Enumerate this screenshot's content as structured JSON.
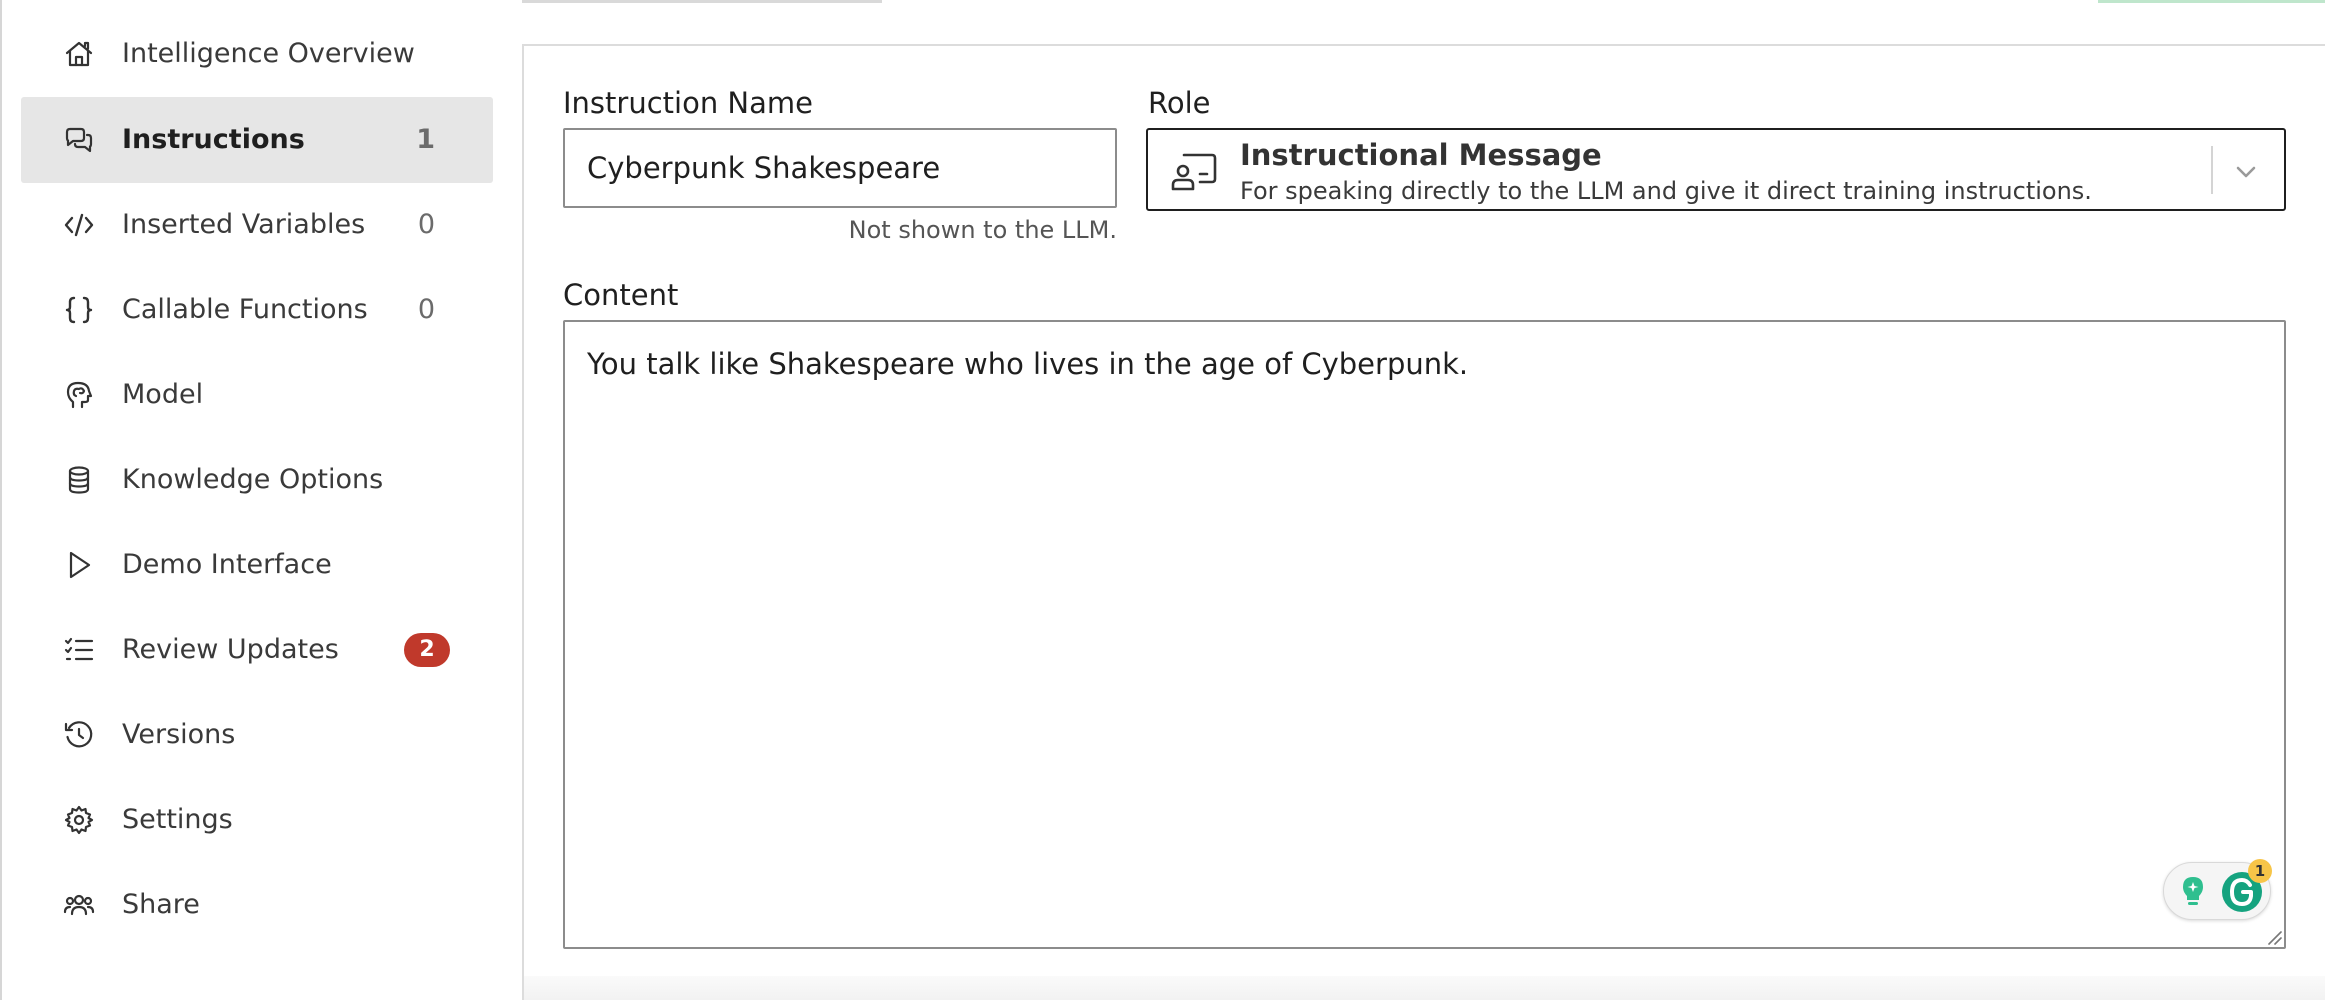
{
  "sidebar": {
    "items": [
      {
        "label": "Intelligence Overview",
        "icon": "home-icon"
      },
      {
        "label": "Instructions",
        "count": "1",
        "icon": "chat-bubbles-icon",
        "active": true
      },
      {
        "label": "Inserted Variables",
        "count": "0",
        "icon": "code-icon"
      },
      {
        "label": "Callable Functions",
        "count": "0",
        "icon": "curly-braces-icon"
      },
      {
        "label": "Model",
        "icon": "head-brain-icon"
      },
      {
        "label": "Knowledge Options",
        "icon": "database-icon"
      },
      {
        "label": "Demo Interface",
        "icon": "play-icon"
      },
      {
        "label": "Review Updates",
        "badge": "2",
        "icon": "checklist-icon"
      },
      {
        "label": "Versions",
        "icon": "history-icon"
      },
      {
        "label": "Settings",
        "icon": "gear-icon"
      },
      {
        "label": "Share",
        "icon": "users-icon"
      }
    ]
  },
  "form": {
    "instruction_name_label": "Instruction Name",
    "instruction_name_value": "Cyberpunk Shakespeare",
    "instruction_name_hint": "Not shown to the LLM.",
    "role_label": "Role",
    "role_value_title": "Instructional Message",
    "role_value_description": "For speaking directly to the LLM and give it direct training instructions.",
    "content_label": "Content",
    "content_value": "You talk like Shakespeare who lives in the age of Cyberpunk."
  },
  "assistant_widget": {
    "notification_count": "1"
  },
  "colors": {
    "active_nav_bg": "#e6e6e6",
    "badge_red": "#c0392b",
    "assistant_green": "#15a37f",
    "assistant_badge": "#f7c548"
  }
}
